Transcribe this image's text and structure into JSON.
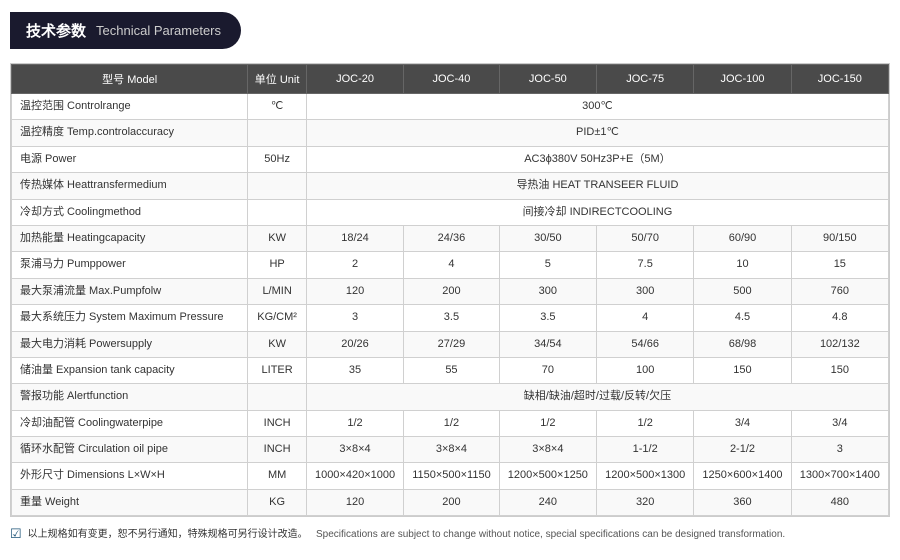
{
  "header": {
    "zh": "技术参数",
    "en": "Technical Parameters"
  },
  "table": {
    "columns": [
      "型号 Model",
      "单位 Unit",
      "JOC-20",
      "JOC-40",
      "JOC-50",
      "JOC-75",
      "JOC-100",
      "JOC-150"
    ],
    "rows": [
      {
        "param": "温控范围 Controlrange",
        "unit": "℃",
        "span": true,
        "spanValue": "300℃"
      },
      {
        "param": "温控精度 Temp.controlaccuracy",
        "unit": "",
        "span": true,
        "spanValue": "PID±1℃"
      },
      {
        "param": "电源 Power",
        "unit": "50Hz",
        "span": true,
        "spanValue": "AC3ϕ380V 50Hz3P+E（5M）"
      },
      {
        "param": "传热媒体 Heattransfermedium",
        "unit": "",
        "span": true,
        "spanValue": "导热油 HEAT TRANSEER FLUID"
      },
      {
        "param": "冷却方式 Coolingmethod",
        "unit": "",
        "span": true,
        "spanValue": "间接冷却 INDIRECTCOOLING"
      },
      {
        "param": "加热能量 Heatingcapacity",
        "unit": "KW",
        "span": false,
        "values": [
          "18/24",
          "24/36",
          "30/50",
          "50/70",
          "60/90",
          "90/150"
        ]
      },
      {
        "param": "泵浦马力 Pumppower",
        "unit": "HP",
        "span": false,
        "values": [
          "2",
          "4",
          "5",
          "7.5",
          "10",
          "15"
        ]
      },
      {
        "param": "最大泵浦流量 Max.Pumpfolw",
        "unit": "L/MIN",
        "span": false,
        "values": [
          "120",
          "200",
          "300",
          "300",
          "500",
          "760"
        ]
      },
      {
        "param": "最大系统压力 System Maximum Pressure",
        "unit": "KG/CM²",
        "span": false,
        "values": [
          "3",
          "3.5",
          "3.5",
          "4",
          "4.5",
          "4.8"
        ]
      },
      {
        "param": "最大电力消耗 Powersupply",
        "unit": "KW",
        "span": false,
        "values": [
          "20/26",
          "27/29",
          "34/54",
          "54/66",
          "68/98",
          "102/132"
        ]
      },
      {
        "param": "储油量 Expansion tank capacity",
        "unit": "LITER",
        "span": false,
        "values": [
          "35",
          "55",
          "70",
          "100",
          "150",
          "150"
        ]
      },
      {
        "param": "警报功能 Alertfunction",
        "unit": "",
        "span": true,
        "spanValue": "缺相/缺油/超时/过载/反转/欠压"
      },
      {
        "param": "冷却油配管 Coolingwaterpipe",
        "unit": "INCH",
        "span": false,
        "values": [
          "1/2",
          "1/2",
          "1/2",
          "1/2",
          "3/4",
          "3/4"
        ]
      },
      {
        "param": "循环水配管 Circulation oil pipe",
        "unit": "INCH",
        "span": false,
        "values": [
          "3×8×4",
          "3×8×4",
          "3×8×4",
          "1-1/2",
          "2-1/2",
          "3"
        ]
      },
      {
        "param": "外形尺寸 Dimensions L×W×H",
        "unit": "MM",
        "span": false,
        "values": [
          "1000×420×1000",
          "1150×500×1150",
          "1200×500×1250",
          "1200×500×1300",
          "1250×600×1400",
          "1300×700×1400"
        ]
      },
      {
        "param": "重量 Weight",
        "unit": "KG",
        "span": false,
        "values": [
          "120",
          "200",
          "240",
          "320",
          "360",
          "480"
        ]
      }
    ]
  },
  "footer": {
    "zh": "以上规格如有变更，恕不另行通知，特殊规格可另行设计改造。",
    "en": "Specifications are subject to change without notice, special specifications can be designed transformation."
  }
}
